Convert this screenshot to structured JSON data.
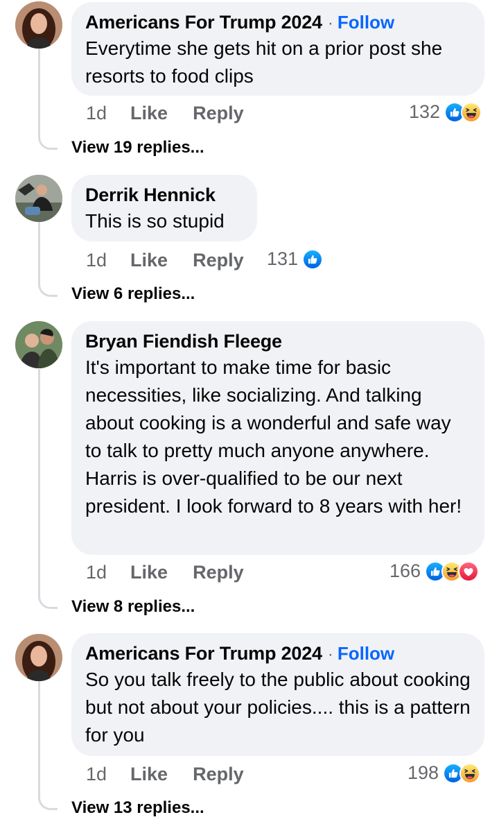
{
  "comments": [
    {
      "author": "Americans For Trump 2024",
      "follow": "Follow",
      "text": "Everytime she gets hit on a prior post she resorts to food clips",
      "time": "1d",
      "like": "Like",
      "reply": "Reply",
      "reaction_count": "132",
      "reactions": [
        "like-icon",
        "haha-icon"
      ],
      "view_replies": "View 19 replies..."
    },
    {
      "author": "Derrik Hennick",
      "text": "This is so stupid",
      "time": "1d",
      "like": "Like",
      "reply": "Reply",
      "reaction_count": "131",
      "reactions": [
        "like-icon"
      ],
      "view_replies": "View 6 replies..."
    },
    {
      "author": "Bryan Fiendish Fleege",
      "text": "It's important to make time for basic necessities, like socializing. And talking about cooking is a wonderful and safe way to talk to pretty much anyone anywhere. Harris is over-qualified to be our next president. I look forward to 8 years with her!",
      "time": "1d",
      "like": "Like",
      "reply": "Reply",
      "reaction_count": "166",
      "reactions": [
        "like-icon",
        "haha-icon",
        "love-icon"
      ],
      "view_replies": "View 8 replies..."
    },
    {
      "author": "Americans For Trump 2024",
      "follow": "Follow",
      "text": "So you talk freely to the public about cooking but not about your policies.... this is a pattern for you",
      "time": "1d",
      "like": "Like",
      "reply": "Reply",
      "reaction_count": "198",
      "reactions": [
        "like-icon",
        "haha-icon"
      ],
      "view_replies": "View 13 replies..."
    }
  ],
  "colors": {
    "follow": "#0866ff",
    "bubble": "#f0f2f5",
    "meta": "#65676b",
    "like_reaction": "#0866ff",
    "haha_reaction": "#f7b928",
    "love_reaction": "#f33e58"
  }
}
